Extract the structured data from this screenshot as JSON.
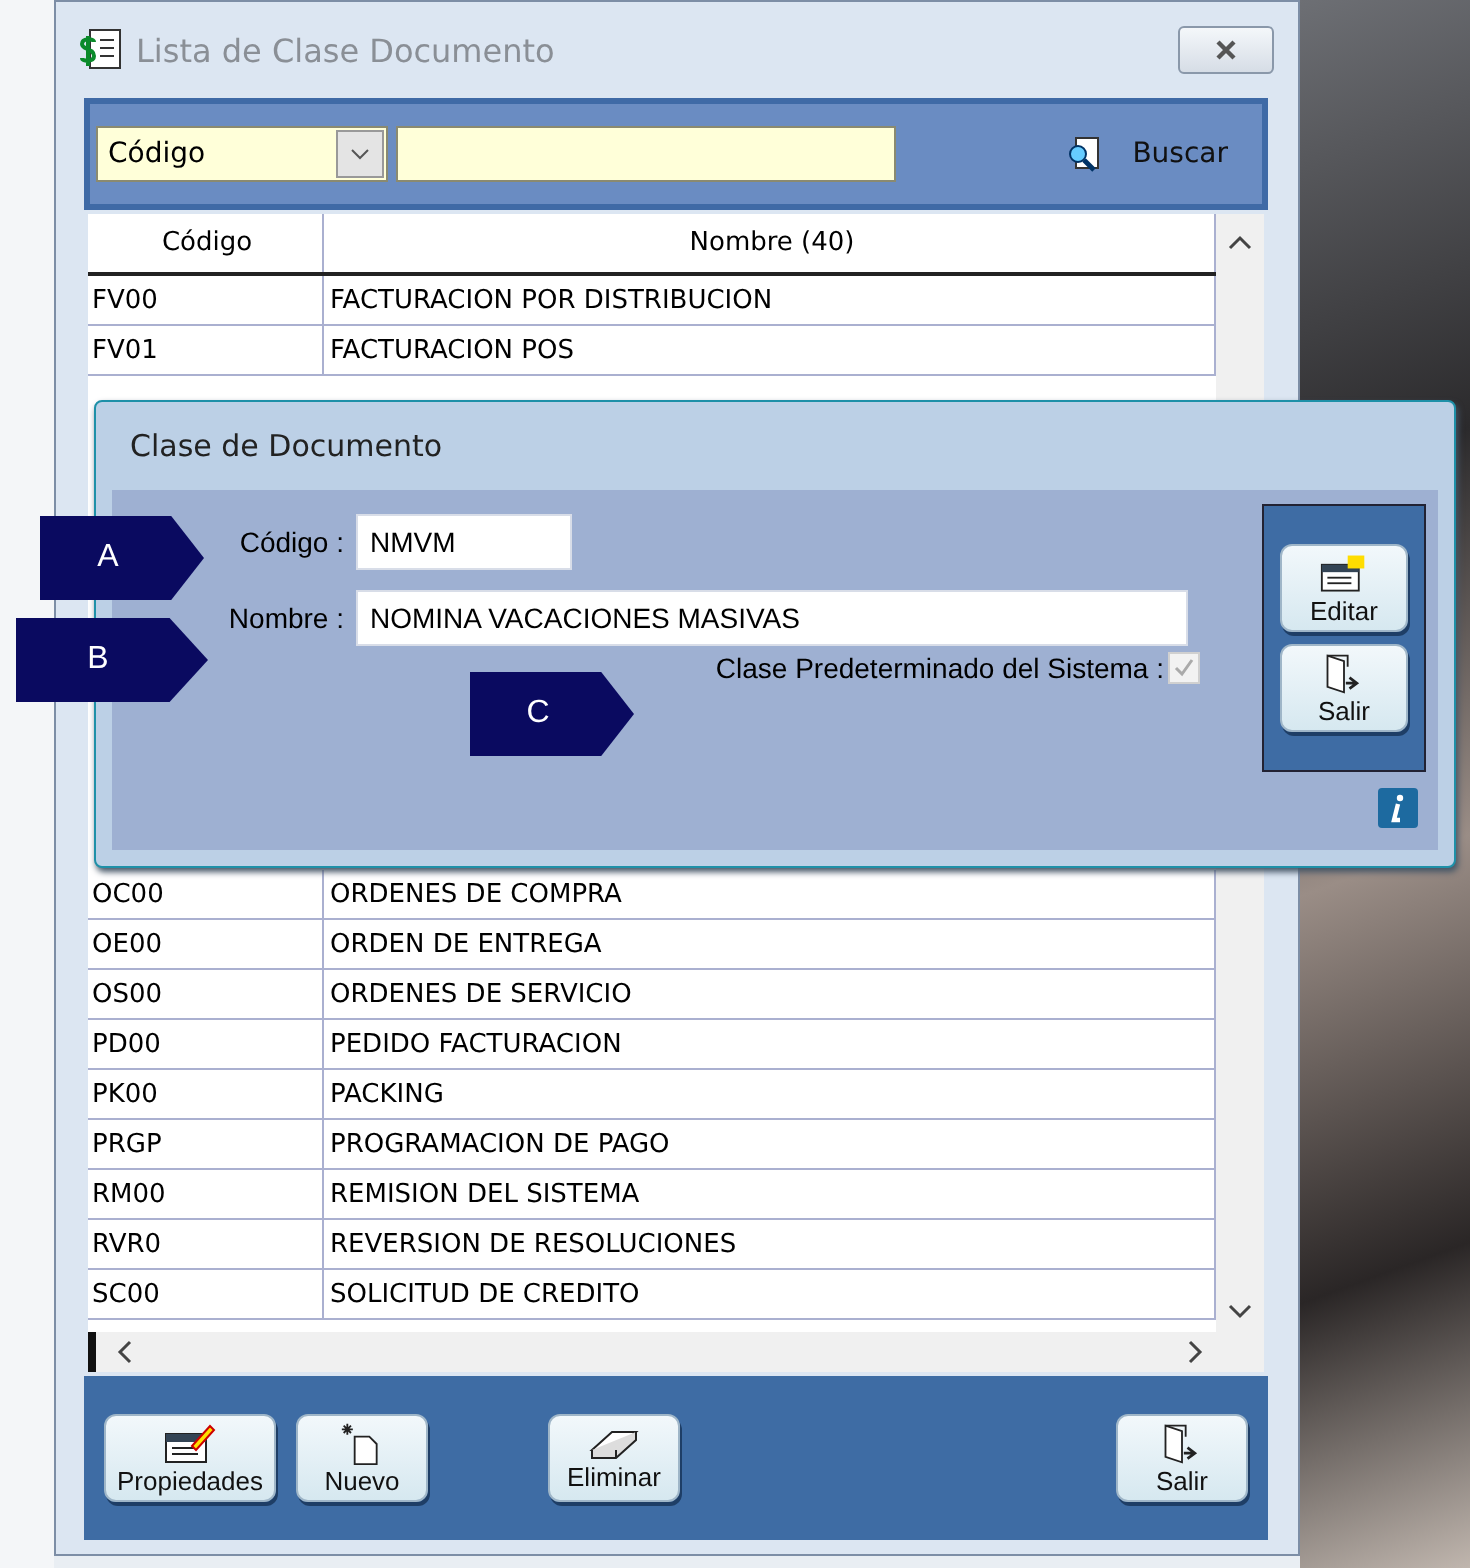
{
  "window": {
    "title": "Lista de Clase Documento"
  },
  "search": {
    "field_option": "Código",
    "button": "Buscar"
  },
  "table": {
    "columns": [
      "Código",
      "Nombre (40)"
    ],
    "rows_before": [
      {
        "code": "FV00",
        "name": "FACTURACION POR DISTRIBUCION"
      },
      {
        "code": "FV01",
        "name": "FACTURACION POS"
      }
    ],
    "rows_after": [
      {
        "code": "OC00",
        "name": "ORDENES DE COMPRA"
      },
      {
        "code": "OE00",
        "name": "ORDEN DE ENTREGA"
      },
      {
        "code": "OS00",
        "name": "ORDENES DE SERVICIO"
      },
      {
        "code": "PD00",
        "name": "PEDIDO FACTURACION"
      },
      {
        "code": "PK00",
        "name": "PACKING"
      },
      {
        "code": "PRGP",
        "name": "PROGRAMACION DE PAGO"
      },
      {
        "code": "RM00",
        "name": "REMISION DEL SISTEMA"
      },
      {
        "code": "RVR0",
        "name": "REVERSION DE RESOLUCIONES"
      },
      {
        "code": "SC00",
        "name": "SOLICITUD DE CREDITO"
      }
    ]
  },
  "buttons": [
    {
      "label": "Propiedades",
      "kind": "properties"
    },
    {
      "label": "Nuevo",
      "kind": "new"
    },
    {
      "label": "Eliminar",
      "kind": "delete"
    },
    {
      "label": "Salir",
      "kind": "exit"
    }
  ],
  "dialog": {
    "title": "Clase de Documento",
    "fields": [
      {
        "label": "Código :",
        "value": "NMVM",
        "kind": "short"
      },
      {
        "label": "Nombre :",
        "value": "NOMINA VACACIONES MASIVAS",
        "kind": "long"
      }
    ],
    "system_default": {
      "label": "Clase Predeterminado del Sistema :",
      "checked": true,
      "disabled": true
    },
    "buttons": [
      {
        "label": "Editar",
        "kind": "edit"
      },
      {
        "label": "Salir",
        "kind": "exit"
      }
    ]
  },
  "callouts": [
    "A",
    "B",
    "C"
  ]
}
